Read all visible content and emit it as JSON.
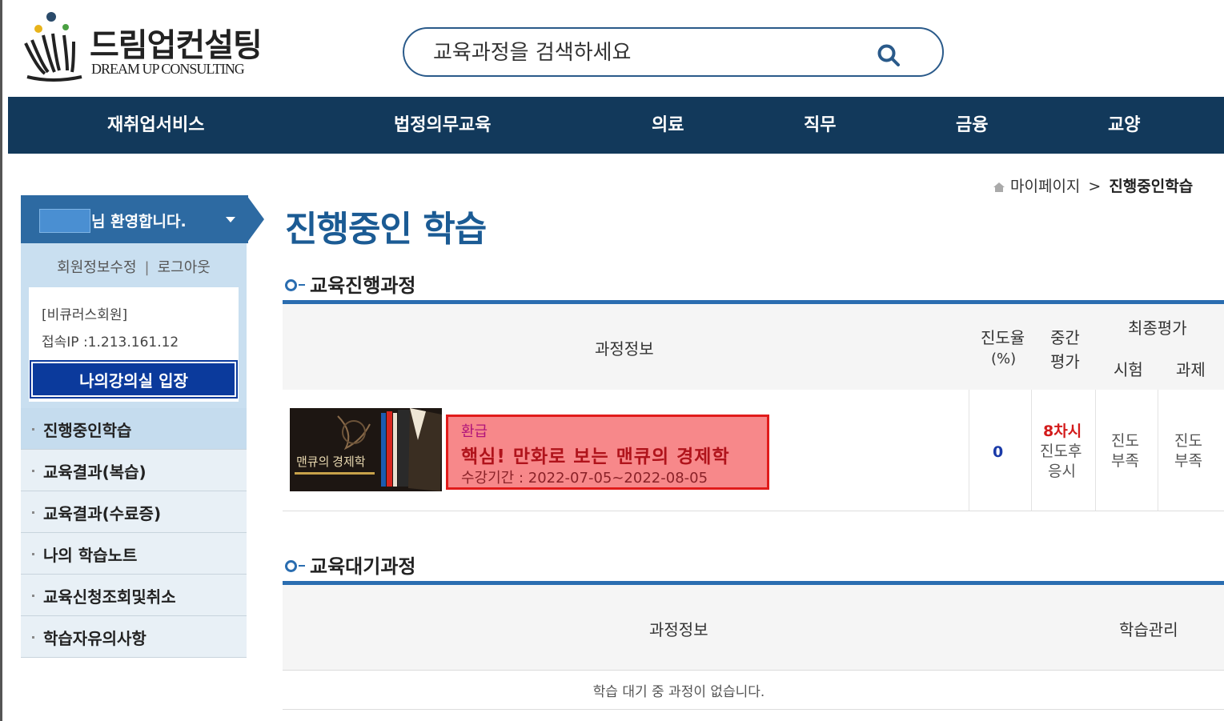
{
  "header": {
    "logo_kr": "드림업컨설팅",
    "logo_en": "DREAM UP CONSULTING",
    "search_placeholder": "교육과정을 검색하세요"
  },
  "nav": [
    "재취업서비스",
    "법정의무교육",
    "의료",
    "직무",
    "금융",
    "교양"
  ],
  "sidebar": {
    "welcome": "님 환영합니다.",
    "edit_info": "회원정보수정",
    "separator": "|",
    "logout": "로그아웃",
    "member_type": "[비큐러스회원]",
    "ip": "접속IP :1.213.161.12",
    "classroom_button": "나의강의실 입장",
    "menu": [
      "진행중인학습",
      "교육결과(복습)",
      "교육결과(수료증)",
      "나의 학습노트",
      "교육신청조회및취소",
      "학습자유의사항"
    ]
  },
  "breadcrumb": {
    "home": "마이페이지",
    "sep": ">",
    "current": "진행중인학습"
  },
  "page_title": "진행중인 학습",
  "in_progress": {
    "title": "교육진행과정",
    "headers": {
      "course_info": "과정정보",
      "progress_1": "진도율",
      "progress_2": "(%)",
      "mid_1": "중간",
      "mid_2": "평가",
      "final": "최종평가",
      "exam": "시험",
      "assignment": "과제"
    },
    "course": {
      "status": "환급",
      "title": "핵심! 만화로 보는 맨큐의 경제학",
      "period": "수강기간 : 2022-07-05~2022-08-05",
      "progress": "0",
      "mid_1": "8차시",
      "mid_2": "진도후",
      "mid_3": "응시",
      "exam_1": "진도",
      "exam_2": "부족",
      "assign_1": "진도",
      "assign_2": "부족"
    },
    "thumb_text": "맨큐의 경제학"
  },
  "waiting": {
    "title": "교육대기과정",
    "headers": {
      "course_info": "과정정보",
      "manage": "학습관리"
    },
    "empty": "학습 대기 중 과정이 없습니다."
  },
  "colors": {
    "nav_bg": "#12395b",
    "accent": "#2a6db0",
    "highlight_border": "#e11b1b"
  }
}
